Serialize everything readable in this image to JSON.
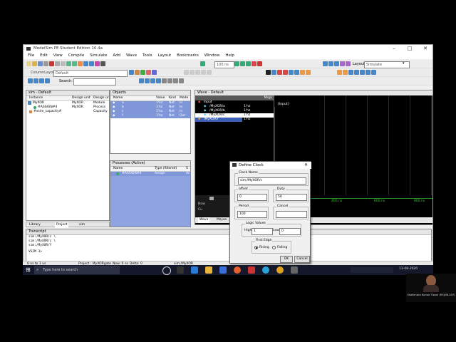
{
  "app": {
    "title": "ModelSim PE Student Edition 10.4a",
    "menu": [
      "File",
      "Edit",
      "View",
      "Compile",
      "Simulate",
      "Add",
      "Wave",
      "Tools",
      "Layout",
      "Bookmarks",
      "Window",
      "Help"
    ],
    "run_length": "100 ns",
    "layout_label": "Layout",
    "layout_value": "Simulate",
    "column_layout_label": "ColumnLayout",
    "column_layout_value": "Default",
    "search_label": "Search:"
  },
  "sim_panel": {
    "title": "sim - Default",
    "columns": [
      "Instance",
      "Design unit",
      "Design ur"
    ],
    "rows": [
      {
        "instance": "MyXOR",
        "unit": "MyXOR",
        "type": "Module"
      },
      {
        "instance": "#ASSIGN#4",
        "unit": "MyXOR",
        "type": "Process"
      },
      {
        "instance": "#vsim_capacity#",
        "unit": "",
        "type": "Capacity"
      }
    ],
    "tabs": [
      "Library",
      "Project",
      "sim"
    ]
  },
  "objects_panel": {
    "title": "Objects",
    "columns": [
      "Name",
      "Value",
      "Kind",
      "Mode"
    ],
    "rows": [
      {
        "name": "a",
        "value": "1'hz",
        "kind": "Net",
        "mode": "In"
      },
      {
        "name": "b",
        "value": "1'hz",
        "kind": "Net",
        "mode": "In"
      },
      {
        "name": "c",
        "value": "1'hz",
        "kind": "Net",
        "mode": "In"
      },
      {
        "name": "f",
        "value": "1'hz",
        "kind": "Net",
        "mode": "Out"
      }
    ]
  },
  "processes_panel": {
    "title": "Processes (Active)",
    "columns": [
      "Name",
      "Type (filtered)",
      "S"
    ],
    "rows": [
      {
        "name": "#ASSIGN#4",
        "type": "Assign",
        "s": "Ac"
      }
    ]
  },
  "wave_panel": {
    "title": "Wave - Default",
    "msgs_label": "Msgs",
    "signals": [
      {
        "name": "Input",
        "value": ""
      },
      {
        "name": "/MyXOR/a",
        "value": "1'hz"
      },
      {
        "name": "/MyXOR/b",
        "value": "1'hz"
      },
      {
        "name": "/MyXOR/c",
        "value": "1'hz"
      },
      {
        "name": "/MyXOR/f",
        "value": "1'hz"
      }
    ],
    "group_label": "{Input}",
    "now_label": "Now",
    "cursor_label": "Cu",
    "time_ticks": [
      "400 ns",
      "600 ns",
      "800 ns"
    ],
    "tabs": [
      "Wave",
      "Msyxo"
    ]
  },
  "transcript": {
    "title": "Transcript",
    "lines": [
      "sim:/MyXOR/c \\",
      "sim:/MyXOR/c \\",
      "sim:/MyXOR/f"
    ],
    "prompt": "VSIM 3>"
  },
  "status_bar": {
    "time_range": "0 ns to 1 us",
    "project": "Project : MyXORgate",
    "now": "Now: 0 ns",
    "delta": "Delta: 0",
    "path": "sim:/MyXOR"
  },
  "dialog": {
    "title": "Define Clock",
    "clock_name_label": "Clock Name",
    "clock_name_value": "sim:/MyXOR/c",
    "offset_label": "offset",
    "offset_value": "0",
    "duty_label": "Duty",
    "duty_value": "50",
    "period_label": "Period",
    "period_value": "100",
    "cancel_group_label": "Cancel",
    "cancel_value": "",
    "logic_values_label": "Logic Values",
    "high_label": "High",
    "high_value": "1",
    "low_label": "Low",
    "low_value": "0",
    "first_edge_label": "First Edge",
    "rising_label": "Rising",
    "falling_label": "Falling",
    "ok_label": "OK",
    "cancel_label": "Cancel"
  },
  "taskbar": {
    "search_placeholder": "Type here to search",
    "time": "",
    "date": "13-08-2020"
  },
  "webcam": {
    "caption": "Shailendra Kumar Tiwari (RS|HB-347)"
  }
}
